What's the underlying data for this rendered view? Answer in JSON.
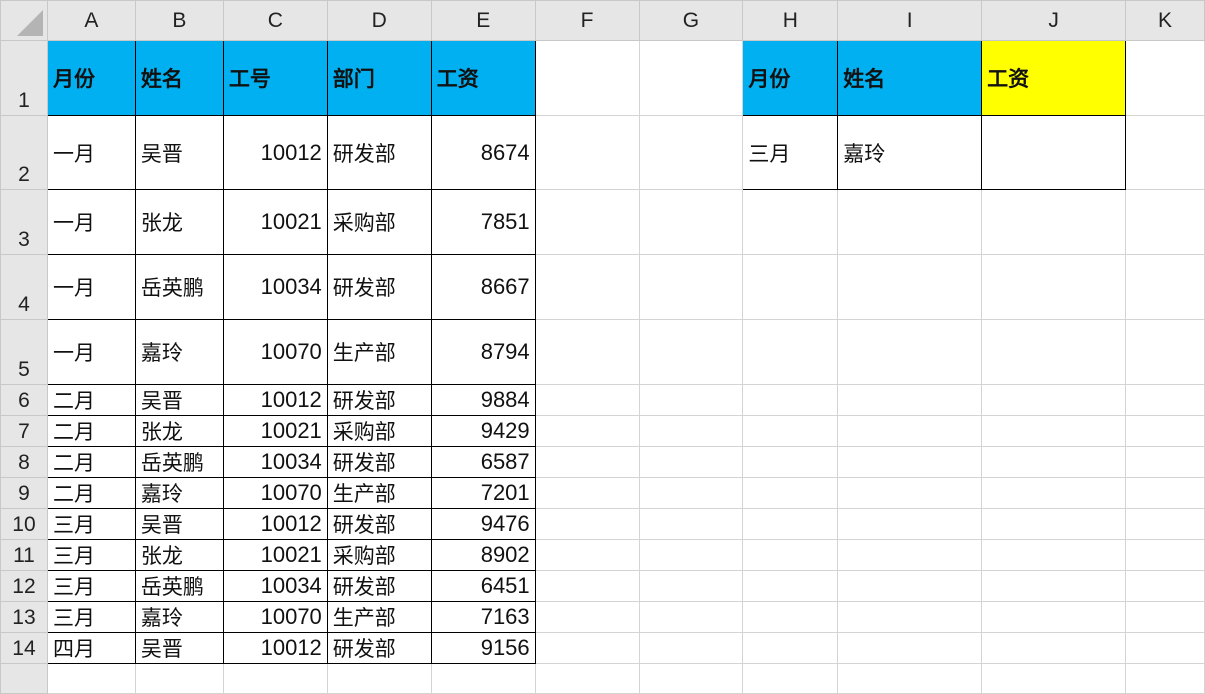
{
  "columns": [
    "A",
    "B",
    "C",
    "D",
    "E",
    "F",
    "G",
    "H",
    "I",
    "J",
    "K"
  ],
  "headers": [
    "月份",
    "姓名",
    "工号",
    "部门",
    "工资"
  ],
  "rows": [
    [
      "一月",
      "吴晋",
      "10012",
      "研发部",
      "8674"
    ],
    [
      "一月",
      "张龙",
      "10021",
      "采购部",
      "7851"
    ],
    [
      "一月",
      "岳英鹏",
      "10034",
      "研发部",
      "8667"
    ],
    [
      "一月",
      "嘉玲",
      "10070",
      "生产部",
      "8794"
    ],
    [
      "二月",
      "吴晋",
      "10012",
      "研发部",
      "9884"
    ],
    [
      "二月",
      "张龙",
      "10021",
      "采购部",
      "9429"
    ],
    [
      "二月",
      "岳英鹏",
      "10034",
      "研发部",
      "6587"
    ],
    [
      "二月",
      "嘉玲",
      "10070",
      "生产部",
      "7201"
    ],
    [
      "三月",
      "吴晋",
      "10012",
      "研发部",
      "9476"
    ],
    [
      "三月",
      "张龙",
      "10021",
      "采购部",
      "8902"
    ],
    [
      "三月",
      "岳英鹏",
      "10034",
      "研发部",
      "6451"
    ],
    [
      "三月",
      "嘉玲",
      "10070",
      "生产部",
      "7163"
    ],
    [
      "四月",
      "吴晋",
      "10012",
      "研发部",
      "9156"
    ]
  ],
  "lookup": {
    "headers": [
      "月份",
      "姓名",
      "工资"
    ],
    "values": [
      "三月",
      "嘉玲",
      ""
    ]
  },
  "row_numbers": [
    "1",
    "2",
    "3",
    "4",
    "5",
    "6",
    "7",
    "8",
    "9",
    "10",
    "11",
    "12",
    "13",
    "14",
    ""
  ],
  "colors": {
    "header_fill": "#00b0f0",
    "highlight_fill": "#ffff00"
  }
}
